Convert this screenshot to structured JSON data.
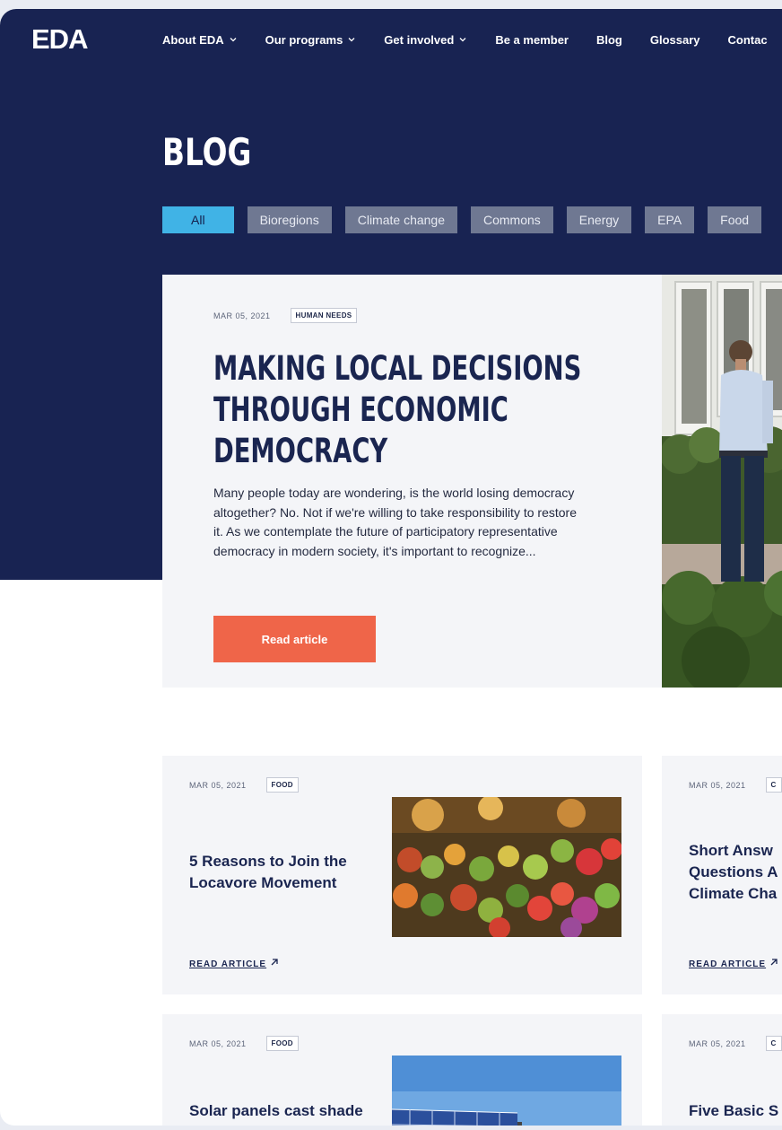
{
  "nav": {
    "logo": "EDA",
    "items": [
      {
        "label": "About EDA",
        "dropdown": true
      },
      {
        "label": "Our programs",
        "dropdown": true
      },
      {
        "label": "Get involved",
        "dropdown": true
      },
      {
        "label": "Be a member",
        "dropdown": false
      },
      {
        "label": "Blog",
        "dropdown": false
      },
      {
        "label": "Glossary",
        "dropdown": false
      },
      {
        "label": "Contac",
        "dropdown": false
      }
    ]
  },
  "page": {
    "title": "BLOG",
    "filters": [
      "All",
      "Bioregions",
      "Climate change",
      "Commons",
      "Energy",
      "EPA",
      "Food"
    ],
    "active_filter": "All"
  },
  "featured": {
    "date": "MAR 05, 2021",
    "tag": "HUMAN NEEDS",
    "title": "Making local decisions through economic democracy",
    "title_lines": [
      "MAKING LOCAL DECISIONS",
      "THROUGH ECONOMIC",
      "DEMOCRACY"
    ],
    "excerpt": "Many people today are wondering, is the world losing democracy altogether? No. Not if we're willing to take responsibility to restore it. As we contemplate the future of participatory representative democracy in modern society, it's important to recognize...",
    "button": "Read article"
  },
  "cards": [
    {
      "date": "MAR 05, 2021",
      "tag": "FOOD",
      "title": "5 Reasons to Join the Locavore Movement",
      "link": "READ ARTICLE"
    },
    {
      "date": "MAR 05, 2021",
      "tag": "C",
      "title": "Short Answ Questions A Climate Cha",
      "link": "READ ARTICLE"
    },
    {
      "date": "MAR 05, 2021",
      "tag": "FOOD",
      "title": "Solar panels cast shade",
      "link": ""
    },
    {
      "date": "MAR 05, 2021",
      "tag": "C",
      "title": "Five Basic S",
      "link": ""
    }
  ],
  "colors": {
    "navy": "#182352",
    "accent": "#ef6549",
    "active_chip": "#40b3e6",
    "chip": "#6f7892"
  }
}
